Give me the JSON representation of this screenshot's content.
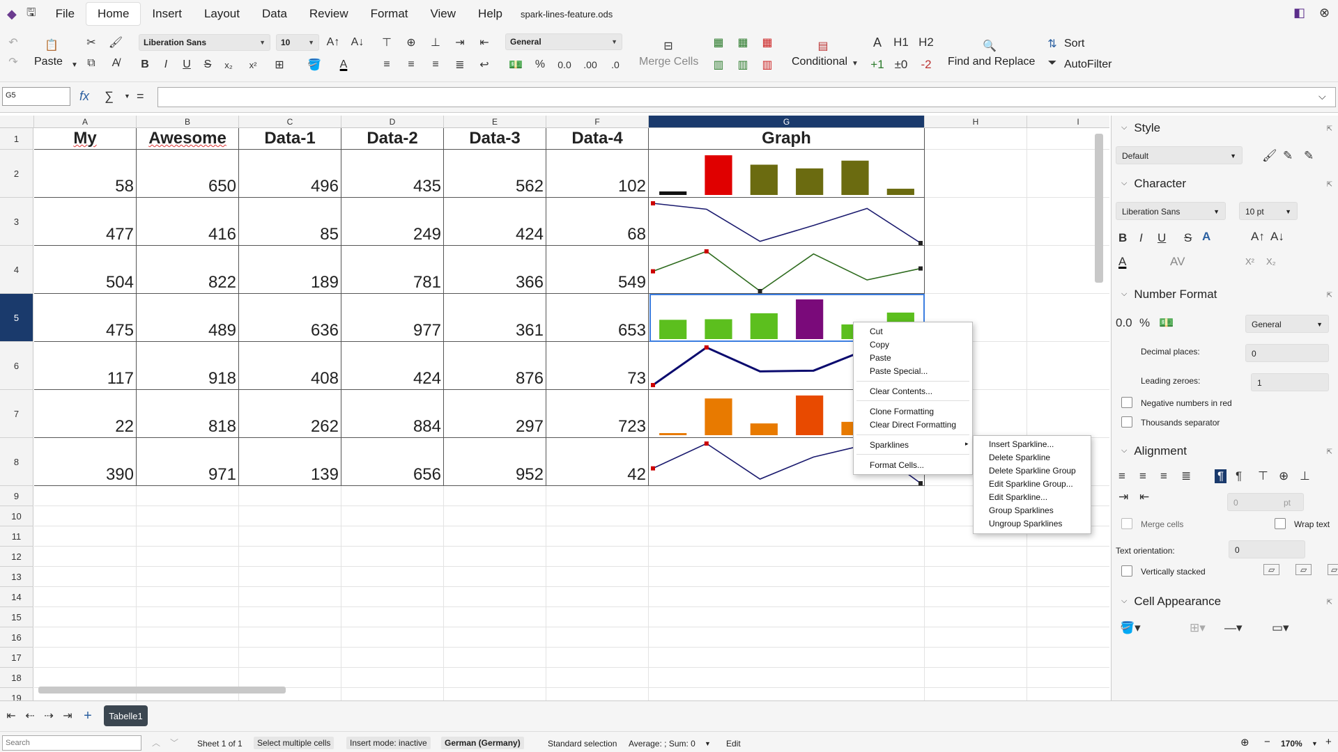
{
  "menubar": {
    "items": [
      "File",
      "Home",
      "Insert",
      "Layout",
      "Data",
      "Review",
      "Format",
      "View",
      "Help"
    ],
    "doc_title": "spark-lines-feature.ods"
  },
  "toolbar": {
    "paste": "Paste",
    "font_name": "Liberation Sans",
    "font_size": "10",
    "number_format": "General",
    "merge_cells": "Merge Cells",
    "conditional": "Conditional",
    "find_replace": "Find and Replace",
    "sort": "Sort",
    "autofilter": "AutoFilter",
    "inc_label": "+1",
    "zero_label": "±0",
    "dec_label": "-2",
    "h1": "H1",
    "h2": "H2",
    "a_letter": "A"
  },
  "formula": {
    "cell_ref": "G5"
  },
  "sheet": {
    "columns": [
      "A",
      "B",
      "C",
      "D",
      "E",
      "F",
      "G",
      "H",
      "I"
    ],
    "row_numbers": [
      "1",
      "2",
      "3",
      "4",
      "5",
      "6",
      "7",
      "8",
      "9",
      "10",
      "11",
      "12",
      "13",
      "14",
      "15",
      "16",
      "17",
      "18",
      "19"
    ],
    "headers": [
      "My",
      "Awesome",
      "Data-1",
      "Data-2",
      "Data-3",
      "Data-4",
      "Graph"
    ],
    "rows": [
      [
        "58",
        "650",
        "496",
        "435",
        "562",
        "102"
      ],
      [
        "477",
        "416",
        "85",
        "249",
        "424",
        "68"
      ],
      [
        "504",
        "822",
        "189",
        "781",
        "366",
        "549"
      ],
      [
        "475",
        "489",
        "636",
        "977",
        "361",
        "653"
      ],
      [
        "117",
        "918",
        "408",
        "424",
        "876",
        "73"
      ],
      [
        "22",
        "818",
        "262",
        "884",
        "297",
        "723"
      ],
      [
        "390",
        "971",
        "139",
        "656",
        "952",
        "42"
      ]
    ]
  },
  "sparklines": [
    {
      "type": "column",
      "values": [
        58,
        650,
        496,
        435,
        562,
        102
      ],
      "colors": [
        "#111111",
        "#e00000",
        "#6b6b10",
        "#6b6b10",
        "#6b6b10",
        "#6b6b10"
      ]
    },
    {
      "type": "line",
      "values": [
        477,
        416,
        85,
        249,
        424,
        68
      ],
      "color": "#1a1a6e"
    },
    {
      "type": "line",
      "values": [
        504,
        822,
        189,
        781,
        366,
        549
      ],
      "color": "#2e6b1e"
    },
    {
      "type": "column",
      "values": [
        475,
        489,
        636,
        977,
        361,
        653
      ],
      "colors": [
        "#5cbf1e",
        "#5cbf1e",
        "#5cbf1e",
        "#7a0a7a",
        "#5cbf1e",
        "#5cbf1e"
      ]
    },
    {
      "type": "line",
      "values": [
        117,
        918,
        408,
        424,
        876,
        73
      ],
      "color": "#0a0a6e"
    },
    {
      "type": "column",
      "values": [
        22,
        818,
        262,
        884,
        297,
        723
      ],
      "colors": [
        "#e87a00",
        "#e87a00",
        "#e87a00",
        "#e84a00",
        "#e87a00",
        "#e87a00"
      ]
    },
    {
      "type": "line",
      "values": [
        390,
        971,
        139,
        656,
        952,
        42
      ],
      "color": "#1a1a6e"
    }
  ],
  "context_menu": {
    "items": [
      "Cut",
      "Copy",
      "Paste",
      "Paste Special...",
      "Clear Contents...",
      "Clone Formatting",
      "Clear Direct Formatting",
      "Sparklines",
      "Format Cells..."
    ]
  },
  "submenu": {
    "items": [
      "Insert Sparkline...",
      "Delete Sparkline",
      "Delete Sparkline Group",
      "Edit Sparkline Group...",
      "Edit Sparkline...",
      "Group Sparklines",
      "Ungroup Sparklines"
    ]
  },
  "sidebar": {
    "style_head": "Style",
    "style_value": "Default",
    "character_head": "Character",
    "font_name": "Liberation Sans",
    "font_size": "10 pt",
    "number_format_head": "Number Format",
    "number_format_value": "General",
    "decimal_places_label": "Decimal places:",
    "decimal_places_value": "0",
    "leading_zeroes_label": "Leading zeroes:",
    "leading_zeroes_value": "1",
    "negative_red": "Negative numbers in red",
    "thousands_sep": "Thousands separator",
    "alignment_head": "Alignment",
    "indent_value": "0",
    "indent_unit": "pt",
    "merge_cells": "Merge cells",
    "wrap_text": "Wrap text",
    "text_orientation_label": "Text orientation:",
    "text_orientation_value": "0",
    "vertically_stacked": "Vertically stacked",
    "cell_appearance_head": "Cell Appearance"
  },
  "tabs": {
    "sheet_name": "Tabelle1"
  },
  "status": {
    "search_placeholder": "Search",
    "sheet_info": "Sheet 1 of 1",
    "selection_mode": "Select multiple cells",
    "insert_mode": "Insert mode: inactive",
    "language": "German (Germany)",
    "standard_selection": "Standard selection",
    "sum_info": "Average: ; Sum: 0",
    "edit": "Edit",
    "zoom": "170%"
  }
}
